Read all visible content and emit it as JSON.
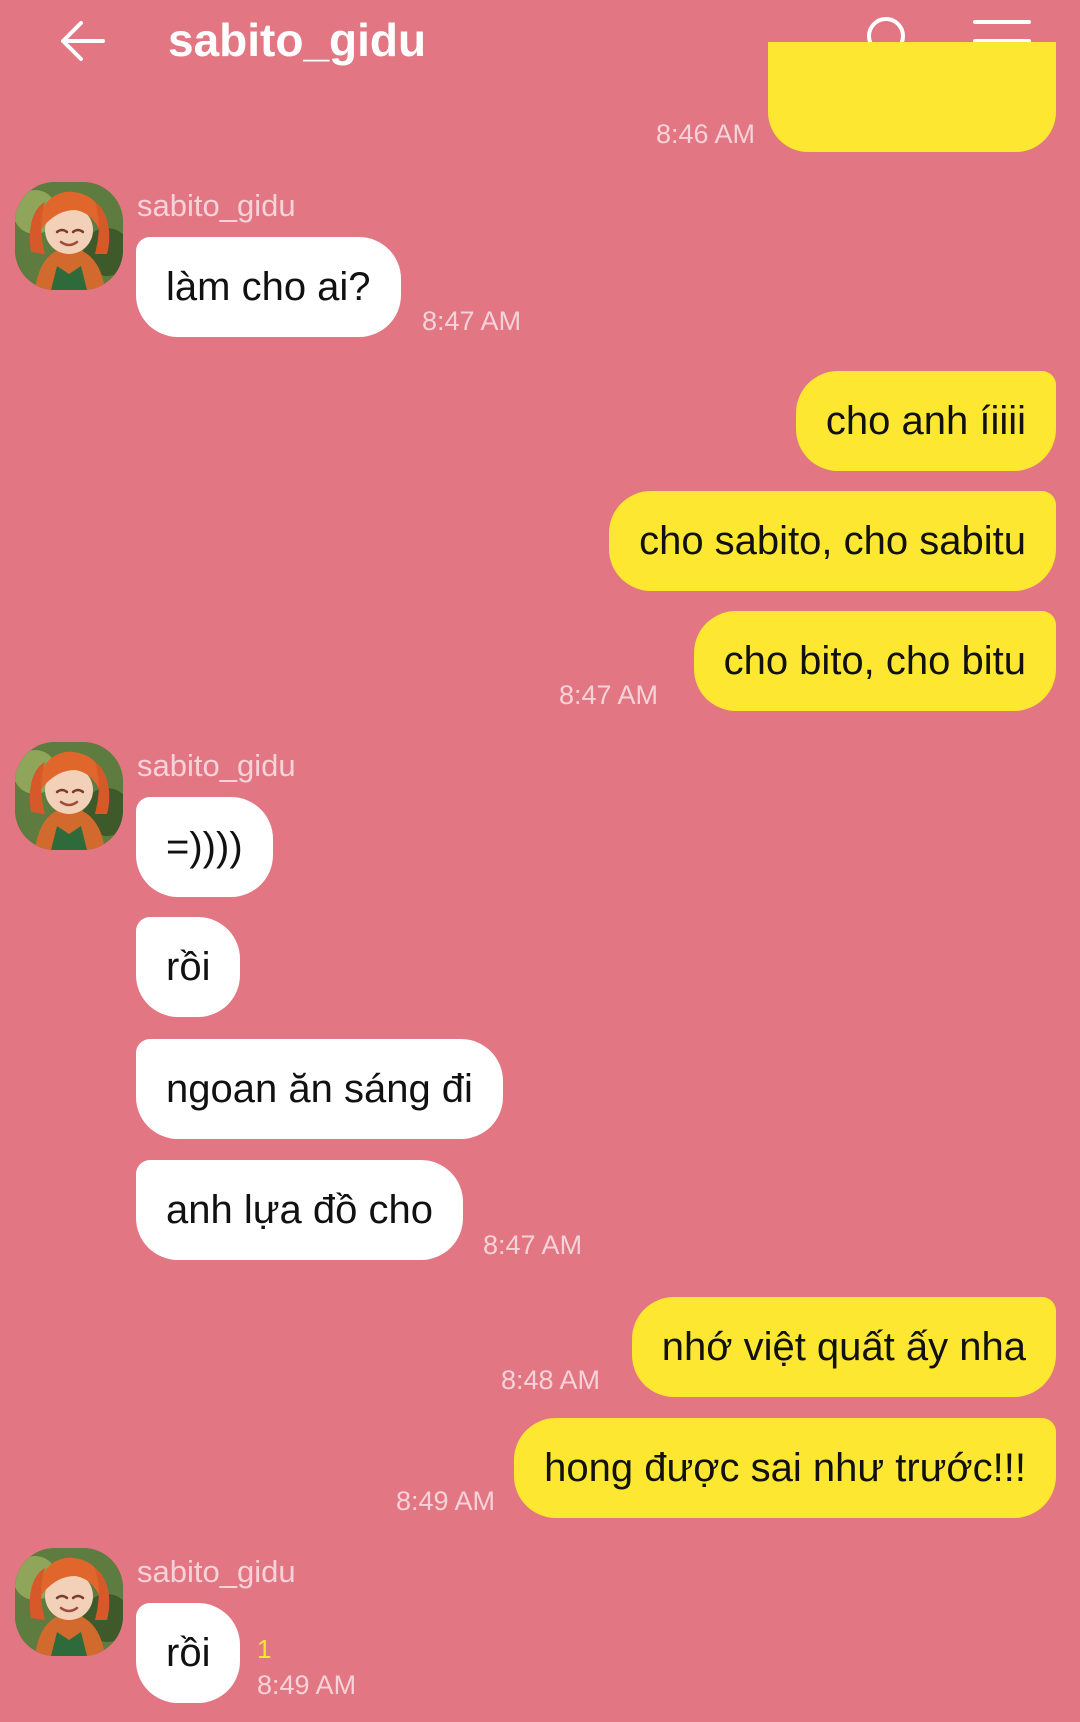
{
  "header": {
    "title": "sabito_gidu"
  },
  "colors": {
    "background": "#E27683",
    "incoming_bubble": "#FFFFFF",
    "outgoing_bubble": "#FDE731",
    "timestamp_text": "#F6D3D8",
    "unread_count": "#FDE731"
  },
  "icons": {
    "back": "back-arrow-icon",
    "search": "search-icon",
    "menu": "menu-icon",
    "avatar": "avatar"
  },
  "messages": {
    "m0": {
      "text": "",
      "time": "8:46 AM"
    },
    "g1": {
      "sender": "sabito_gidu",
      "m1": {
        "text": "làm cho ai?",
        "time": "8:47 AM"
      }
    },
    "m2": {
      "text": "cho anh íiiii"
    },
    "m3": {
      "text": "cho sabito, cho sabitu"
    },
    "m4": {
      "text": "cho bito, cho bitu",
      "time": "8:47 AM"
    },
    "g2": {
      "sender": "sabito_gidu",
      "m5": {
        "text": "=))))"
      },
      "m6": {
        "text": "rồi"
      },
      "m7": {
        "text": "ngoan ăn sáng đi"
      },
      "m8": {
        "text": "anh lựa đồ cho",
        "time": "8:47 AM"
      }
    },
    "m9": {
      "text": "nhớ việt quất ấy nha",
      "time": "8:48 AM"
    },
    "m10": {
      "text": "hong được sai như trước!!!",
      "time": "8:49 AM"
    },
    "g3": {
      "sender": "sabito_gidu",
      "m11": {
        "text": "rồi",
        "unread": "1",
        "time": "8:49 AM"
      }
    }
  }
}
